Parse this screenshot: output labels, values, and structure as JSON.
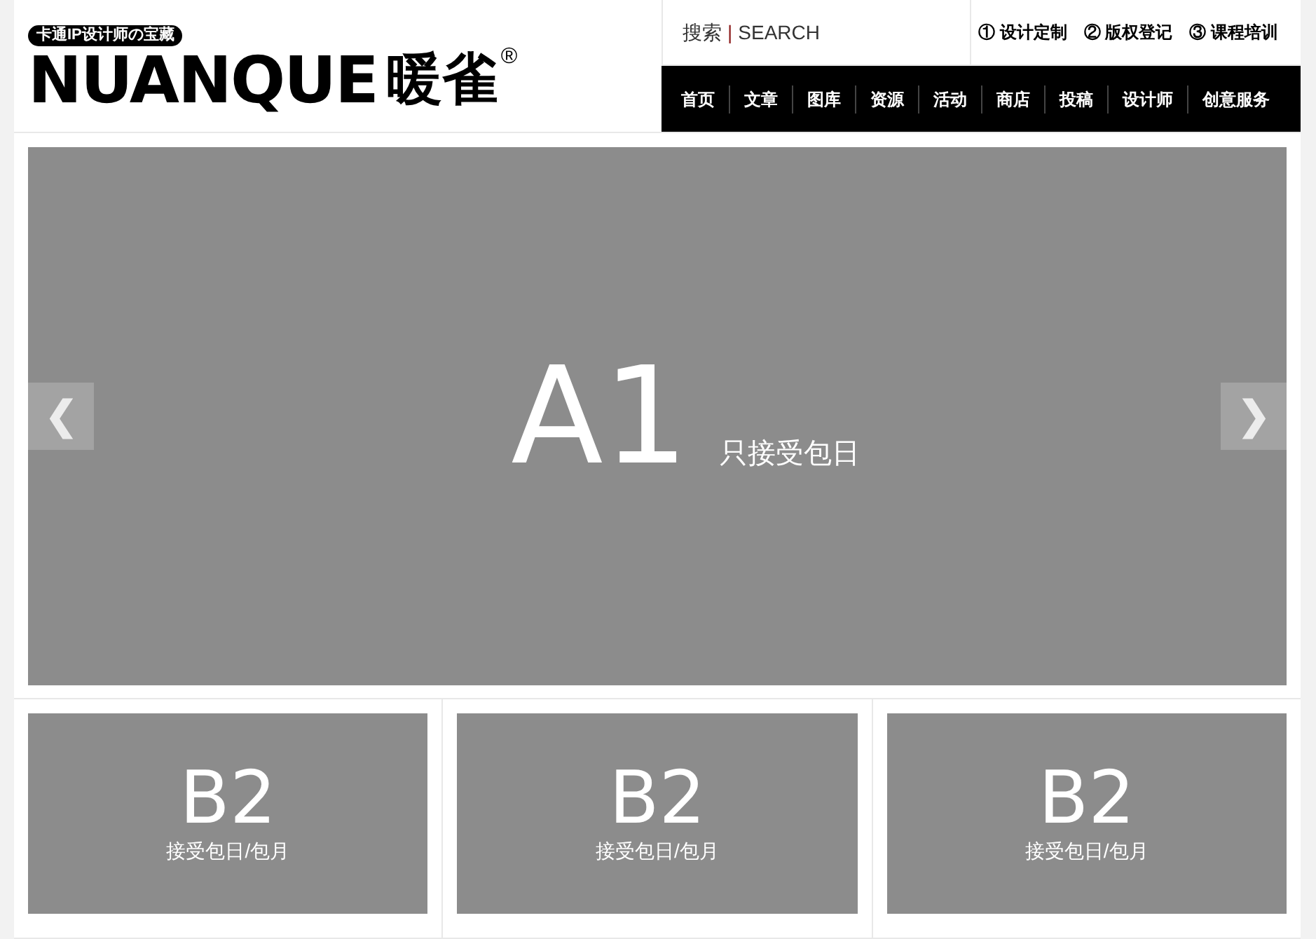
{
  "logo": {
    "tagline": "卡通IP设计师の宝藏",
    "name": "NUANQUE",
    "name_cn": "暖雀",
    "mark": "®"
  },
  "search": {
    "label": "搜索",
    "separator": "|",
    "hint": "SEARCH"
  },
  "top_links": [
    {
      "number": "①",
      "label": "设计定制"
    },
    {
      "number": "②",
      "label": "版权登记"
    },
    {
      "number": "③",
      "label": "课程培训"
    }
  ],
  "nav": [
    "首页",
    "文章",
    "图库",
    "资源",
    "活动",
    "商店",
    "投稿",
    "设计师",
    "创意服务"
  ],
  "banner": {
    "title": "A1",
    "subtitle": "只接受包日",
    "prev": "❮",
    "next": "❯"
  },
  "ads": [
    {
      "title": "B2",
      "subtitle": "接受包日/包月"
    },
    {
      "title": "B2",
      "subtitle": "接受包日/包月"
    },
    {
      "title": "B2",
      "subtitle": "接受包日/包月"
    }
  ]
}
